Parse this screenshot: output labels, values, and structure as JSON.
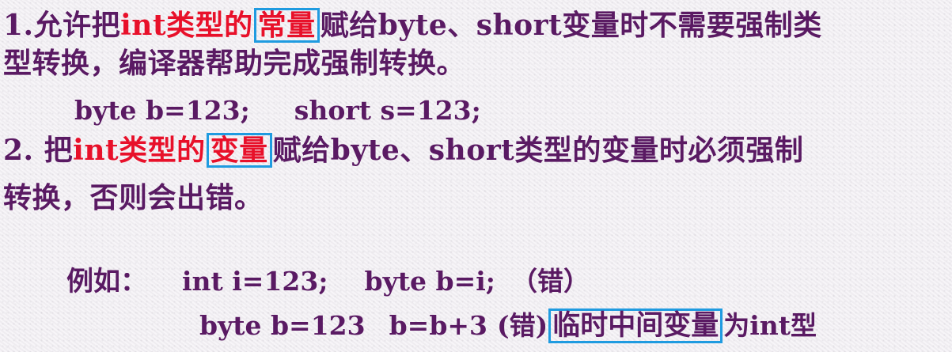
{
  "rule1": {
    "number": "1.",
    "pre_a": "允许把",
    "red_a": "int类型的",
    "boxed": "常量",
    "rest_line1": "赋给byte、short变量时不需要强制类",
    "line2": "型转换，编译器帮助完成强制转换。",
    "example_a": "byte b=123;",
    "example_b": "short s=123;"
  },
  "rule2": {
    "number": "2. ",
    "pre_a": "把",
    "red_a": "int类型的",
    "boxed": "变量",
    "rest_line1": "赋给byte、short类型的变量时必须强制",
    "line2": "转换，否则会出错。"
  },
  "examples": {
    "label": "例如：",
    "line1_a": "int i=123;",
    "line1_b": "byte b=i;",
    "line1_c": "（错）",
    "line2_a": "byte b=123",
    "line2_b": "b=b+3",
    "line2_c": "(错)",
    "line2_boxed": "临时中间变量",
    "line2_d": "为int型"
  },
  "colors": {
    "text": "#5a1a63",
    "highlight": "#e8102a",
    "box_border": "#1f9be0"
  }
}
